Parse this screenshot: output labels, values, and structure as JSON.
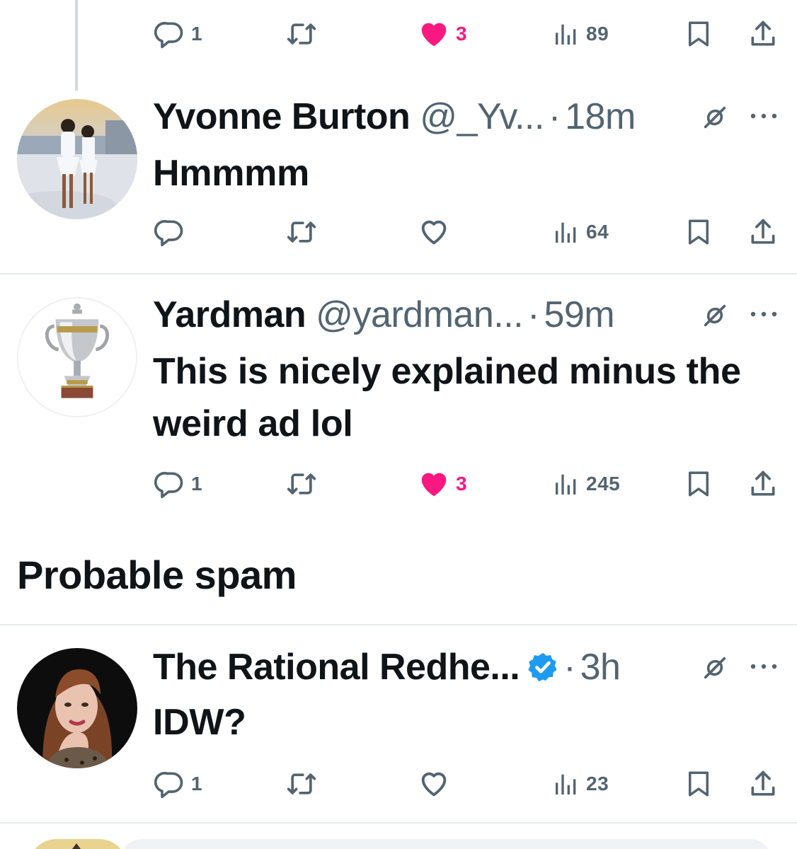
{
  "top_actions": {
    "replies": "1",
    "likes": "3",
    "views": "89"
  },
  "tweets": [
    {
      "name": "Yvonne Burton",
      "handle": "@_Yv...",
      "dot": "·",
      "time": "18m",
      "text": "Hmmmm",
      "actions": {
        "replies": "",
        "likes": "",
        "views": "64"
      }
    },
    {
      "name": "Yardman",
      "handle": "@yardman...",
      "dot": "·",
      "time": "59m",
      "text": "This is nicely explained minus the weird ad lol",
      "actions": {
        "replies": "1",
        "likes": "3",
        "views": "245"
      }
    },
    {
      "name": "The Rational Redhe...",
      "handle": "",
      "dot": "·",
      "time": "3h",
      "text": "IDW?",
      "actions": {
        "replies": "1",
        "likes": "",
        "views": "23"
      }
    }
  ],
  "section": {
    "title": "Probable spam"
  },
  "colors": {
    "text": "#0f1419",
    "muted": "#536471",
    "like": "#f91880",
    "verified": "#1d9bf0",
    "divider": "#e6e9eb"
  },
  "icons": [
    "reply-icon",
    "retweet-icon",
    "like-icon",
    "views-icon",
    "bookmark-icon",
    "share-icon",
    "grok-icon",
    "more-icon",
    "verified-icon"
  ]
}
